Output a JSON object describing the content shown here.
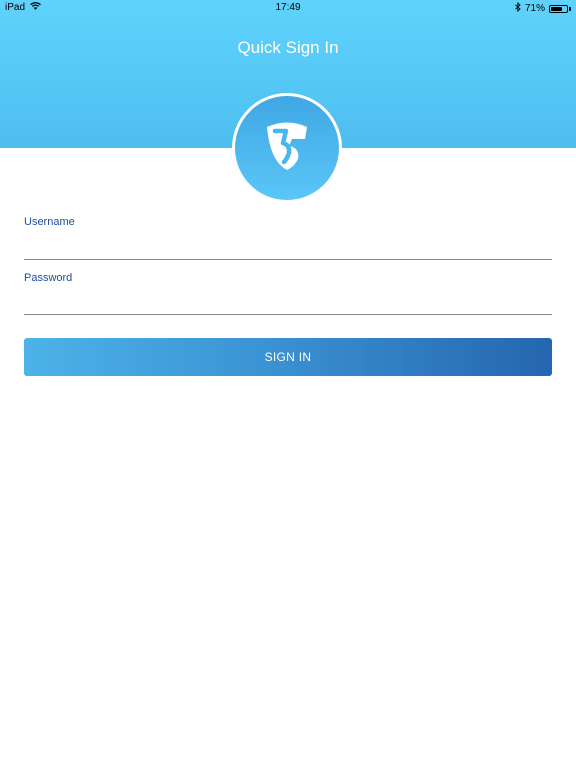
{
  "status_bar": {
    "device": "iPad",
    "time": "17:49",
    "battery_text": "71%",
    "battery_level": 0.71
  },
  "header": {
    "title": "Quick Sign In"
  },
  "form": {
    "username_label": "Username",
    "username_value": "",
    "password_label": "Password",
    "password_value": "",
    "sign_in_label": "SIGN IN"
  },
  "colors": {
    "header": "#5fd2fd",
    "label": "#1d4f9c",
    "button_start": "#4cb3e8",
    "button_end": "#2566b0"
  },
  "icons": {
    "status": [
      "wifi-icon",
      "bluetooth-icon",
      "battery-icon"
    ],
    "logo": "shield-logo-icon"
  }
}
